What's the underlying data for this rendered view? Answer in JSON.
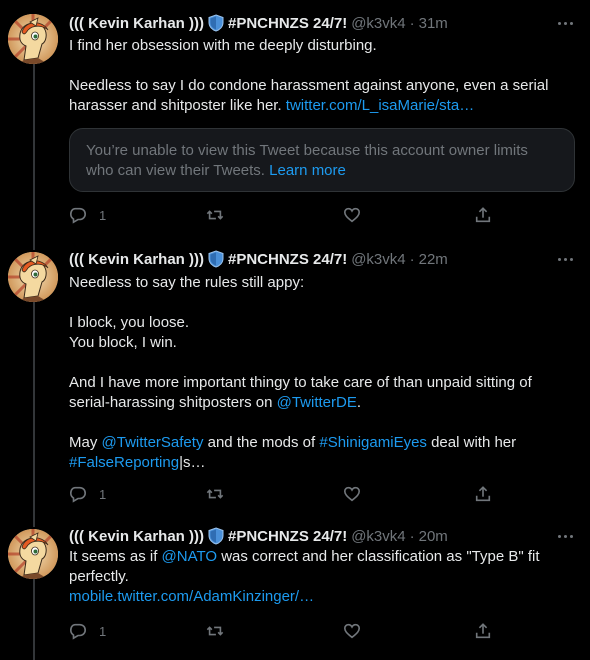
{
  "tweets": [
    {
      "name": "((( Kevin Karhan )))",
      "tag": "#PNCHNZS 24/7!",
      "handle": "@k3vk4",
      "sep": "·",
      "time": "31m",
      "lines": [
        [
          {
            "t": "I find her obsession with me deeply disturbing."
          }
        ],
        [],
        [
          {
            "t": "Needless to say I do condone harassment against anyone, even a serial"
          }
        ],
        [
          {
            "t": "harasser and shitposter like her. "
          },
          {
            "t": "twitter.com/L_isaMarie/sta…",
            "link": true
          }
        ]
      ],
      "quote": {
        "text": "You’re unable to view this Tweet because this account owner limits who can view their Tweets. ",
        "link": "Learn more"
      },
      "reply_count": "1"
    },
    {
      "name": "((( Kevin Karhan )))",
      "tag": "#PNCHNZS 24/7!",
      "handle": "@k3vk4",
      "sep": "·",
      "time": "22m",
      "lines": [
        [
          {
            "t": "Needless to say the rules still appy:"
          }
        ],
        [],
        [
          {
            "t": "I block, you loose."
          }
        ],
        [
          {
            "t": "You block, I win."
          }
        ],
        [],
        [
          {
            "t": "And I have more important thingy to take care of than unpaid sitting of"
          }
        ],
        [
          {
            "t": "serial-harassing shitposters on "
          },
          {
            "t": "@TwitterDE",
            "link": true
          },
          {
            "t": "."
          }
        ],
        [],
        [
          {
            "t": "May "
          },
          {
            "t": "@TwitterSafety",
            "link": true
          },
          {
            "t": " and the mods of "
          },
          {
            "t": "#ShinigamiEyes",
            "link": true
          },
          {
            "t": " deal with her"
          }
        ],
        [
          {
            "t": "#FalseReporting",
            "link": true
          },
          {
            "t": "|s…"
          }
        ]
      ],
      "reply_count": "1"
    },
    {
      "name": "((( Kevin Karhan )))",
      "tag": "#PNCHNZS 24/7!",
      "handle": "@k3vk4",
      "sep": "·",
      "time": "20m",
      "lines": [
        [
          {
            "t": "It seems as if "
          },
          {
            "t": "@NATO",
            "link": true
          },
          {
            "t": " was correct and her classification as \"Type B\" fit"
          }
        ],
        [
          {
            "t": "perfectly."
          }
        ],
        [
          {
            "t": "mobile.twitter.com/AdamKinzinger/…",
            "link": true
          }
        ]
      ],
      "reply_count": "1"
    }
  ],
  "colors": {
    "background": "#000000",
    "link": "#1d9bf0",
    "muted": "#71767b",
    "text": "#e7e9ea",
    "shield": "#4a90d9"
  },
  "icons": [
    "more-icon",
    "reply-icon",
    "retweet-icon",
    "like-icon",
    "share-icon",
    "shield-icon"
  ]
}
